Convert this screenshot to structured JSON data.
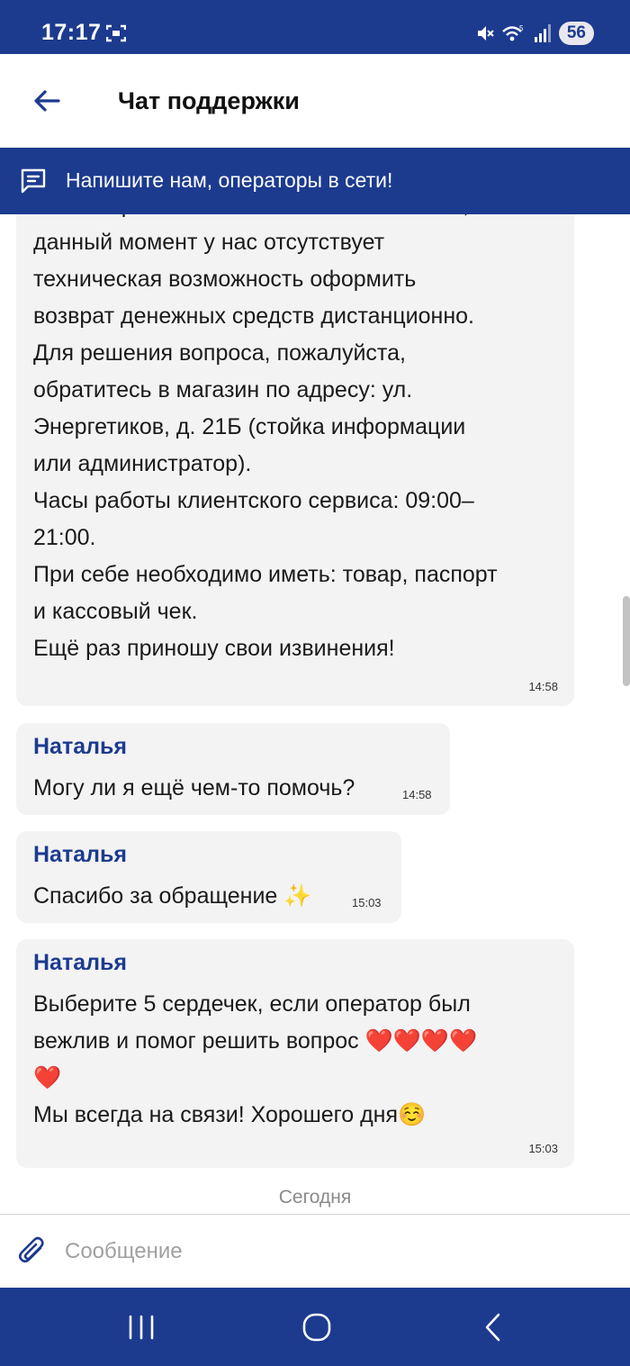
{
  "status_bar": {
    "time": "17:17",
    "battery": "56",
    "icons": [
      "screen-record-icon",
      "mute-icon",
      "wifi-icon",
      "signal-icon"
    ]
  },
  "header": {
    "title": "Чат поддержки",
    "back_icon": "arrow-left-icon"
  },
  "banner": {
    "text": "Напишите нам, операторы в сети!",
    "icon": "chat-icon"
  },
  "messages": [
    {
      "text": "свои искренние извинения. К сожалению, в\nданный момент у нас отсутствует\nтехническая возможность оформить\nвозврат денежных средств дистанционно.\nДля решения вопроса, пожалуйста,\nобратитесь в магазин по адресу: ул.\nЭнергетиков, д. 21Б (стойка информации\nили администратор).\nЧасы работы клиентского сервиса: 09:00–\n21:00.\nПри себе необходимо иметь: товар, паспорт\nи кассовый чек.\nЕщё раз приношу свои извинения!",
      "time": "14:58"
    },
    {
      "sender": "Наталья",
      "text": "Могу ли я ещё чем-то помочь?",
      "time": "14:58"
    },
    {
      "sender": "Наталья",
      "text": "Спасибо за обращение ✨",
      "time": "15:03"
    },
    {
      "sender": "Наталья",
      "text": "Выберите 5 сердечек, если оператор был\nвежлив и помог решить вопрос ❤️❤️❤️❤️\n❤️\nМы всегда на связи! Хорошего дня☺️",
      "time": "15:03"
    }
  ],
  "date_separator": "Сегодня",
  "composer": {
    "placeholder": "Сообщение",
    "value": ""
  },
  "nav_bar": {
    "buttons": [
      "recent-apps",
      "home",
      "back"
    ]
  },
  "colors": {
    "brand": "#1c3b8f",
    "bubble": "#f3f3f4",
    "sender": "#1c3b8f"
  }
}
